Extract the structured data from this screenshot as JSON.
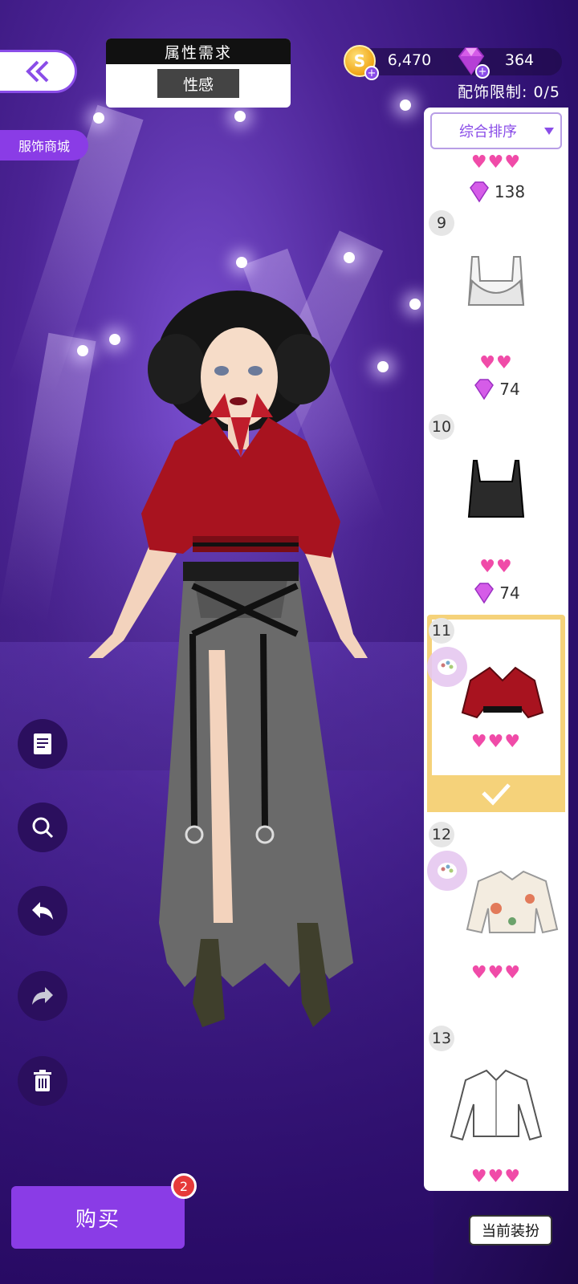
{
  "header": {
    "attribute_title": "属性需求",
    "attribute_tag": "性感",
    "shop_label": "服饰商城"
  },
  "currency": {
    "coins": "6,470",
    "gems": "364",
    "accessory_limit": "配饰限制: 0/5"
  },
  "panel": {
    "sort_label": "综合排序",
    "items": [
      {
        "number": "",
        "hearts": "♥♥♥",
        "price": "138",
        "icon": "partial-item"
      },
      {
        "number": "9",
        "hearts": "♥♥",
        "price": "74",
        "icon": "white-crop-bra-top-icon"
      },
      {
        "number": "10",
        "hearts": "♥♥",
        "price": "74",
        "icon": "black-cami-top-icon"
      },
      {
        "number": "11",
        "hearts": "♥♥♥",
        "price": "",
        "icon": "red-cropped-shirt-icon",
        "selected": true
      },
      {
        "number": "12",
        "hearts": "♥♥♥",
        "price": "",
        "icon": "floral-blouse-icon"
      },
      {
        "number": "13",
        "hearts": "♥♥♥",
        "price": "",
        "icon": "white-shirt-icon"
      }
    ]
  },
  "tools": [
    "notes-icon",
    "zoom-icon",
    "undo-icon",
    "redo-icon",
    "trash-icon"
  ],
  "footer": {
    "buy_label": "购买",
    "buy_badge": "2",
    "current_outfit_label": "当前装扮"
  },
  "colors": {
    "accent": "#8a3ce6",
    "heart": "#f04ba8",
    "selected": "#f5d27a"
  }
}
